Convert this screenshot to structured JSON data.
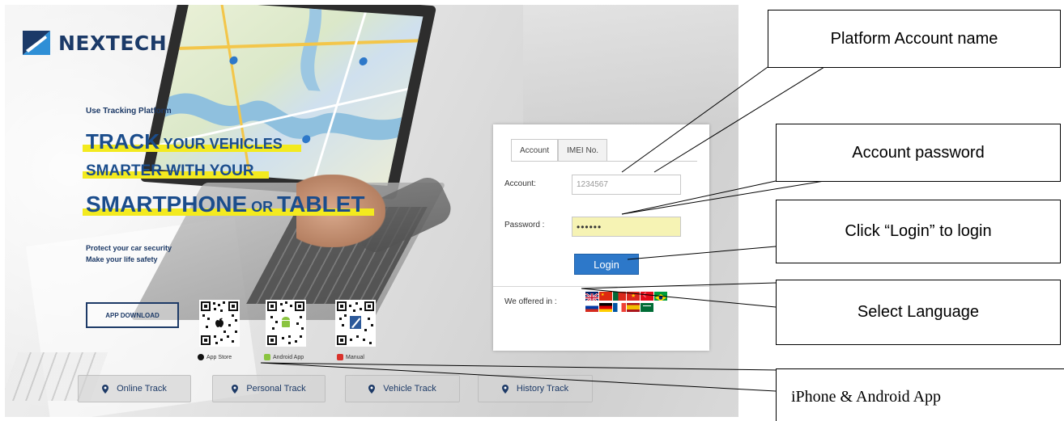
{
  "brand": {
    "name": "NEXTECH"
  },
  "hero": {
    "tagline": "Use Tracking Platform",
    "line1_bold": "TRACK",
    "line1_rest": " YOUR VEHICLES",
    "line2": "SMARTER WITH YOUR",
    "line3_a": "SMARTPHONE",
    "line3_b": " OR ",
    "line3_c": "TABLET",
    "sub1": "Protect your car security",
    "sub2": "Make your life safety"
  },
  "app_download": {
    "label": "APP DOWNLOAD"
  },
  "qr_codes": [
    {
      "caption": "App Store",
      "icon": "apple-icon"
    },
    {
      "caption": "Android App",
      "icon": "android-icon"
    },
    {
      "caption": "Manual",
      "icon": "manual-icon"
    }
  ],
  "nav": [
    {
      "label": "Online Track",
      "icon": "location-pin-icon"
    },
    {
      "label": "Personal Track",
      "icon": "location-pin-icon"
    },
    {
      "label": "Vehicle Track",
      "icon": "location-pin-icon"
    },
    {
      "label": "History Track",
      "icon": "location-pin-icon"
    }
  ],
  "login_panel": {
    "tabs": [
      "Account",
      "IMEI No."
    ],
    "active_tab": "Account",
    "account_label": "Account:",
    "account_value": "1234567",
    "password_label": "Password :",
    "password_value": "••••••",
    "login_label": "Login",
    "languages_label": "We offered in :",
    "flags": [
      "uk",
      "china",
      "portugal",
      "vietnam",
      "turkey",
      "brazil",
      "russia",
      "germany",
      "france",
      "spain",
      "saudi-arabia"
    ]
  },
  "callouts": {
    "account_name": "Platform Account name",
    "account_password": "Account password",
    "login": "Click “Login” to login",
    "language": "Select Language",
    "apps": "iPhone & Android App"
  },
  "colors": {
    "brand_navy": "#1b3a68",
    "headline_blue": "#1b4d8c",
    "highlight_yellow": "#f3ea1f",
    "login_blue": "#2d78c9",
    "password_fill": "#f6f3b4"
  }
}
